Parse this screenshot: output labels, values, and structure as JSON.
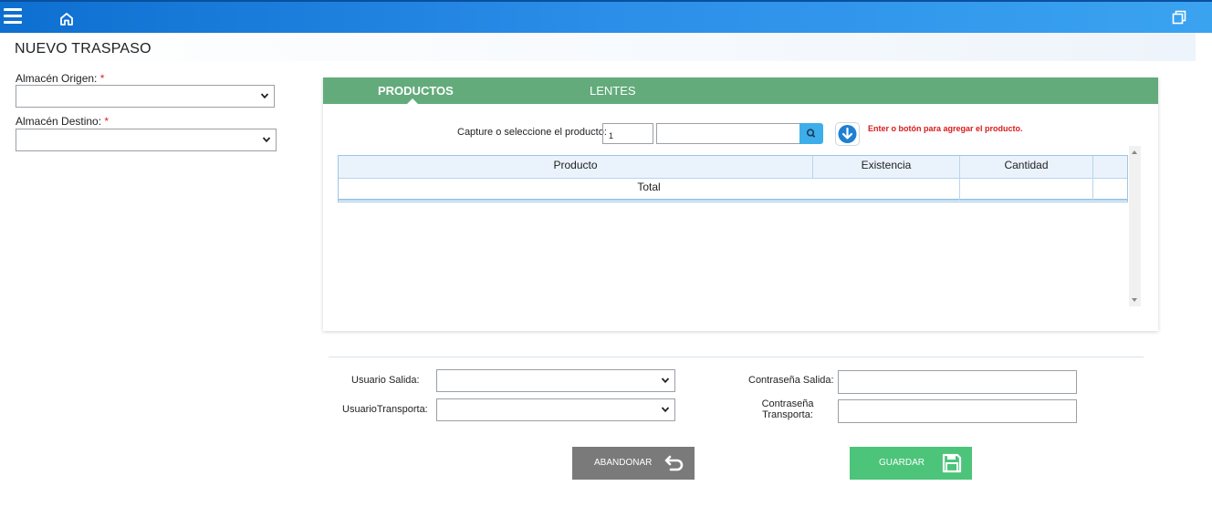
{
  "header": {
    "menu_icon": "hamburger-menu-icon",
    "home_icon": "home-icon",
    "window_icon": "restore-window-icon"
  },
  "page": {
    "title": "NUEVO TRASPASO"
  },
  "left_form": {
    "origen_label": "Almacén Origen:",
    "origen_required": "*",
    "origen_value": "",
    "destino_label": "Almacén Destino:",
    "destino_required": "*",
    "destino_value": ""
  },
  "tabs": [
    {
      "label": "PRODUCTOS",
      "active": true
    },
    {
      "label": "LENTES",
      "active": false
    }
  ],
  "capture": {
    "label": "Capture o seleccione el producto:",
    "quantity": "1",
    "search_value": "",
    "hint": "Enter o botón para agregar el producto."
  },
  "table": {
    "headers": [
      "Producto",
      "Existencia",
      "Cantidad",
      ""
    ],
    "total_label": "Total",
    "total_value": ""
  },
  "bottom_form": {
    "usuario_salida_label": "Usuario Salida:",
    "usuario_salida_value": "",
    "usuario_transporta_label": "UsuarioTransporta:",
    "usuario_transporta_value": "",
    "contrasena_salida_label": "Contraseña Salida:",
    "contrasena_salida_value": "",
    "contrasena_transporta_label_1": "Contraseña",
    "contrasena_transporta_label_2": "Transporta:",
    "contrasena_transporta_value": ""
  },
  "buttons": {
    "abandon_label": "ABANDONAR",
    "abandon_icon": "undo-arrow-icon",
    "save_label": "GUARDAR",
    "save_icon": "floppy-disk-icon"
  },
  "colors": {
    "topbar": "#2b8ee8",
    "tab_bar": "#63ab7b",
    "save_button": "#4cc47a",
    "abandon_button": "#7a7a7a",
    "hint_text": "#d81b1b",
    "search_button": "#3daee9"
  }
}
